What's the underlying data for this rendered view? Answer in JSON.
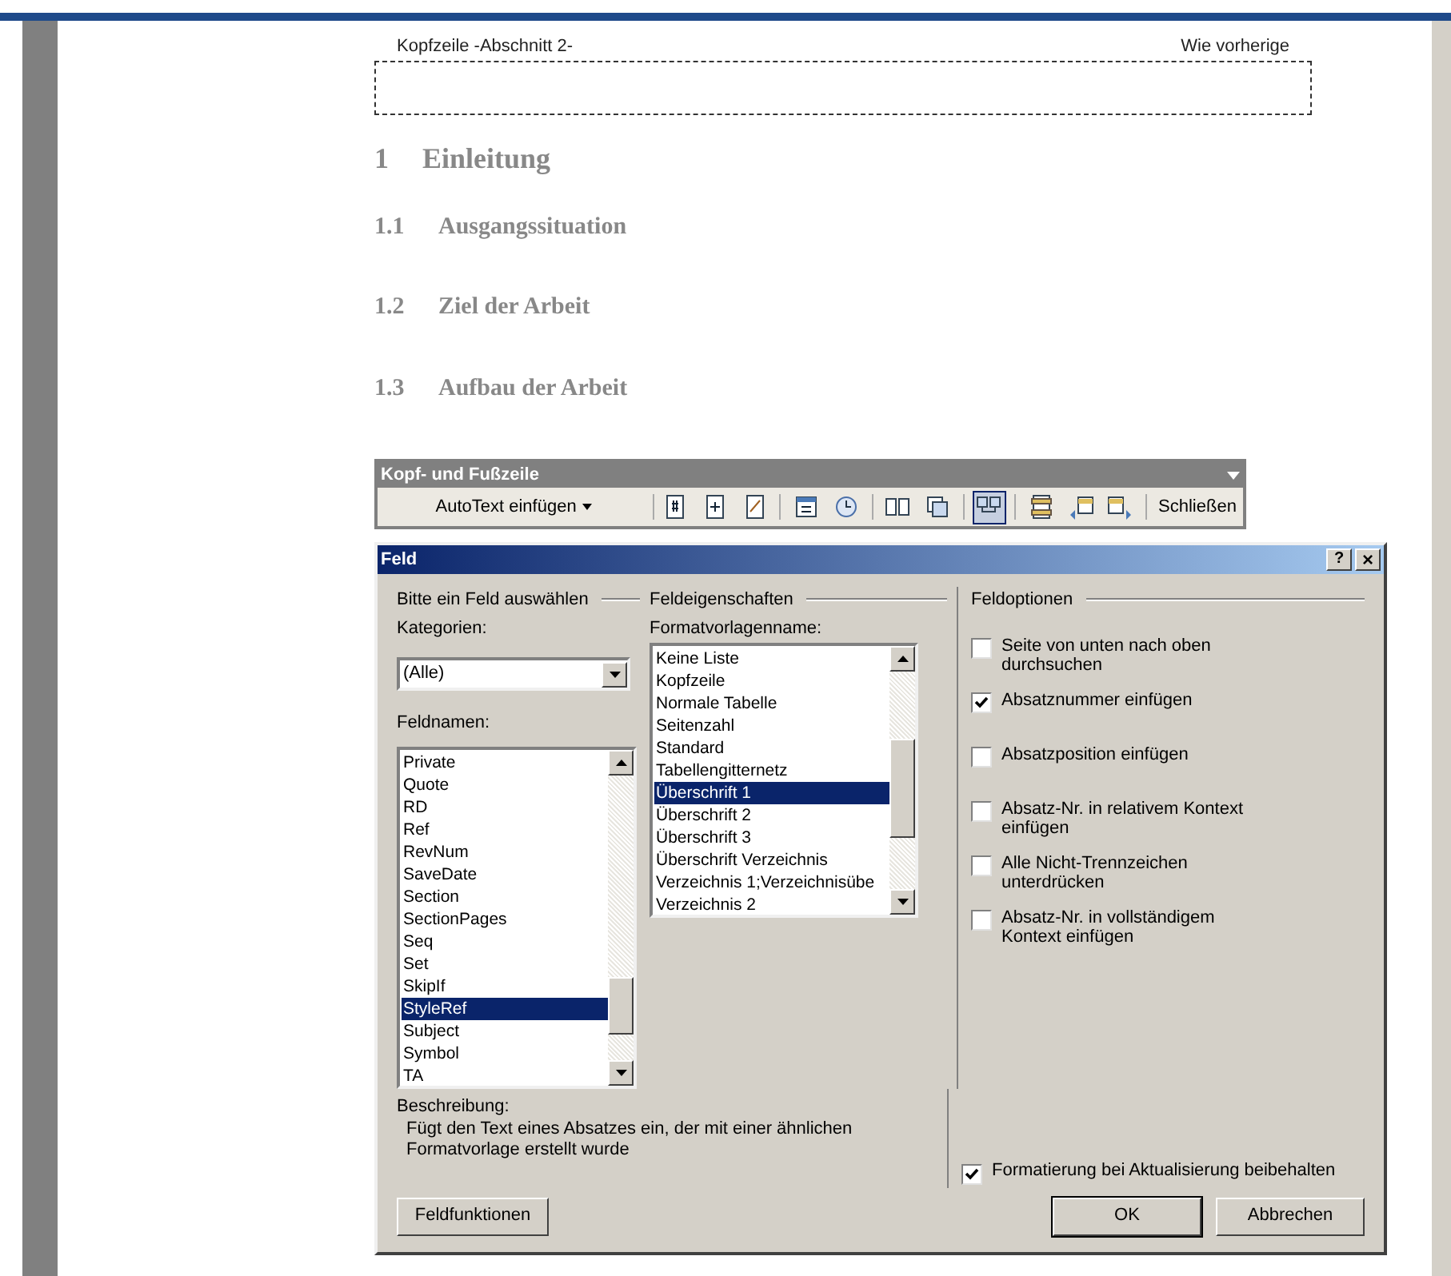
{
  "header": {
    "label": "Kopfzeile -Abschnitt 2-",
    "link_label": "Wie vorherige"
  },
  "headings": [
    {
      "number": "1",
      "text": "Einleitung",
      "kind": "chapter"
    },
    {
      "number": "1.1",
      "text": "Ausgangssituation",
      "kind": "section"
    },
    {
      "number": "1.2",
      "text": "Ziel der Arbeit",
      "kind": "section"
    },
    {
      "number": "1.3",
      "text": "Aufbau der Arbeit",
      "kind": "section"
    }
  ],
  "toolbar": {
    "title": "Kopf- und Fußzeile",
    "autotext_button": "AutoText einfügen",
    "icon_buttons": [
      {
        "selected": false
      },
      {
        "selected": false
      },
      {
        "selected": false
      },
      {
        "selected": false
      },
      {
        "selected": false
      },
      {
        "selected": false
      },
      {
        "selected": false
      },
      {
        "selected": true
      },
      {
        "selected": false
      },
      {
        "selected": false
      },
      {
        "selected": false
      }
    ],
    "close_button": "Schließen"
  },
  "dialog": {
    "title": "Feld",
    "help_button": "?",
    "close_button": "×",
    "select_group": "Bitte ein Feld auswählen",
    "categories_label": "Kategorien:",
    "categories_value": "(Alle)",
    "fieldnames_label": "Feldnamen:",
    "fieldnames": [
      {
        "label": "Private",
        "selected": false
      },
      {
        "label": "Quote",
        "selected": false
      },
      {
        "label": "RD",
        "selected": false
      },
      {
        "label": "Ref",
        "selected": false
      },
      {
        "label": "RevNum",
        "selected": false
      },
      {
        "label": "SaveDate",
        "selected": false
      },
      {
        "label": "Section",
        "selected": false
      },
      {
        "label": "SectionPages",
        "selected": false
      },
      {
        "label": "Seq",
        "selected": false
      },
      {
        "label": "Set",
        "selected": false
      },
      {
        "label": "SkipIf",
        "selected": false
      },
      {
        "label": "StyleRef",
        "selected": true
      },
      {
        "label": "Subject",
        "selected": false
      },
      {
        "label": "Symbol",
        "selected": false
      },
      {
        "label": "TA",
        "selected": false
      }
    ],
    "properties_group": "Feldeigenschaften",
    "style_label": "Formatvorlagenname:",
    "styles": [
      {
        "label": "Keine Liste",
        "selected": false
      },
      {
        "label": "Kopfzeile",
        "selected": false
      },
      {
        "label": "Normale Tabelle",
        "selected": false
      },
      {
        "label": "Seitenzahl",
        "selected": false
      },
      {
        "label": "Standard",
        "selected": false
      },
      {
        "label": "Tabellengitternetz",
        "selected": false
      },
      {
        "label": "Überschrift 1",
        "selected": true
      },
      {
        "label": "Überschrift 2",
        "selected": false
      },
      {
        "label": "Überschrift 3",
        "selected": false
      },
      {
        "label": "Überschrift Verzeichnis",
        "selected": false
      },
      {
        "label": "Verzeichnis 1;Verzeichnisübe",
        "selected": false
      },
      {
        "label": "Verzeichnis 2",
        "selected": false
      }
    ],
    "options_group": "Feldoptionen",
    "options": [
      {
        "label": "Seite von unten nach oben durchsuchen",
        "checked": false
      },
      {
        "label": "Absatznummer einfügen",
        "checked": true
      },
      {
        "label": "Absatzposition einfügen",
        "checked": false
      },
      {
        "label": "Absatz-Nr. in relativem Kontext einfügen",
        "checked": false
      },
      {
        "label": "Alle Nicht-Trennzeichen unterdrücken",
        "checked": false
      },
      {
        "label": "Absatz-Nr. in vollständigem Kontext einfügen",
        "checked": false
      }
    ],
    "description_label": "Beschreibung:",
    "description": "Fügt den Text eines Absatzes ein, der mit einer ähnlichen Formatvorlage erstellt wurde",
    "keep_format": {
      "label": "Formatierung bei Aktualisierung beibehalten",
      "checked": true
    },
    "field_codes_button": "Feldfunktionen",
    "ok_button": "OK",
    "cancel_button": "Abbrechen"
  }
}
